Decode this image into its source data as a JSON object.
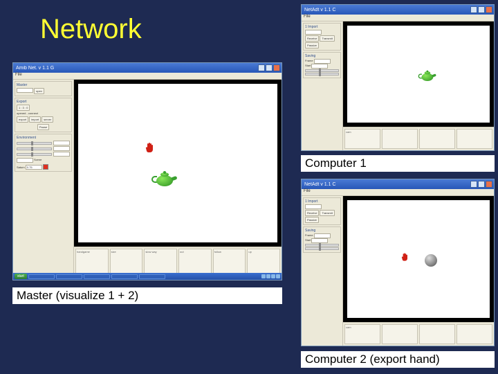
{
  "slide": {
    "title": "Network",
    "captions": {
      "master": "Master (visualize 1 + 2)",
      "c1": "Computer 1",
      "c2": "Computer 2 (export hand)"
    }
  },
  "master_window": {
    "title": "Amib Net. v 1.1 G",
    "menubar": "File",
    "sidebar": {
      "master_label": "Master",
      "ip_open_btn": "open",
      "export_label": "Export",
      "export_btn": "1 : 3 : 0",
      "conn_status": "opened - connect",
      "buttons": {
        "export": "export",
        "import": "import",
        "server": "server"
      },
      "pause_btn": "Pause",
      "environment_label": "Environment",
      "env_scene": "Scene",
      "saturn_label": "Saturn",
      "saturn_input": "0.75"
    },
    "bottom": {
      "labels": [
        "handgame",
        "size",
        "slow way",
        "out",
        "follow",
        "up"
      ]
    },
    "objects": {
      "teapot": true,
      "hand": true
    }
  },
  "c1_window": {
    "title": "NetAdt v 1.1 C",
    "menubar": "File",
    "sidebar": {
      "group1": "1 Import",
      "buttons1": [
        "Receive",
        "Transmit",
        "Passive"
      ],
      "group2": "Saving",
      "inputs": [
        "Frame",
        "Start"
      ]
    },
    "bottom": {
      "labels": [
        "cam",
        "",
        "",
        ""
      ]
    },
    "objects": {
      "teapot": true
    }
  },
  "c2_window": {
    "title": "NetAdt v 1.1 C",
    "menubar": "File",
    "sidebar": {
      "group1": "1 Import",
      "buttons1": [
        "Receive",
        "Transmit",
        "Passive"
      ],
      "group2": "Saving",
      "inputs": [
        "Frame",
        "Start"
      ]
    },
    "bottom": {
      "labels": [
        "cam",
        "",
        "",
        ""
      ]
    },
    "objects": {
      "hand": true,
      "sphere": true
    }
  },
  "taskbar": {
    "start": "start"
  }
}
